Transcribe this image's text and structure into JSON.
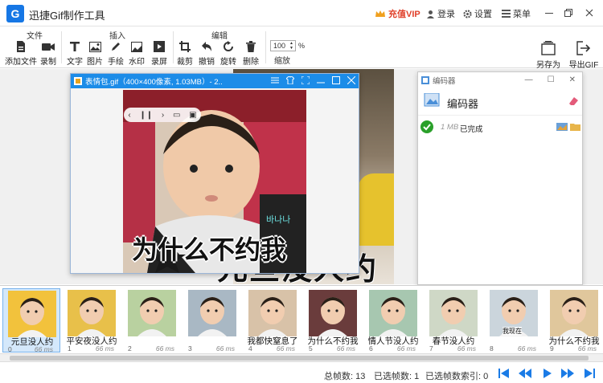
{
  "app": {
    "title": "迅捷Gif制作工具",
    "logo_letter": "G",
    "vip_label": "充值VIP",
    "login_label": "登录",
    "settings_label": "设置",
    "menu_label": "菜单"
  },
  "toolbar": {
    "groups": {
      "file": "文件",
      "insert": "插入",
      "edit": "编辑"
    },
    "add_file": "添加文件",
    "record": "录制",
    "text": "文字",
    "image": "图片",
    "draw": "手绘",
    "watermark": "水印",
    "screen_record": "录屏",
    "crop": "裁剪",
    "undo": "撤销",
    "rotate": "旋转",
    "delete": "删除",
    "zoom_value": "100",
    "zoom_unit": "%",
    "zoom_label": "缩放",
    "save_as": "另存为",
    "export_gif": "导出GIF"
  },
  "preview": {
    "title": "表情包.gif（400×400像素, 1.03MB）- 2...",
    "caption": "为什么不约我",
    "background_caption": "元旦没人约"
  },
  "encoder": {
    "window_label": "编码器",
    "title": "编码器",
    "size": "1 MB",
    "status": "已完成"
  },
  "frames": [
    {
      "index": "0",
      "caption": "元旦没人约",
      "ms": "66 ms",
      "tone": "#f2c23c"
    },
    {
      "index": "1",
      "caption": "平安夜没人约",
      "ms": "66 ms",
      "tone": "#e8c04a"
    },
    {
      "index": "2",
      "caption": "",
      "ms": "66 ms",
      "tone": "#b9d1a0"
    },
    {
      "index": "3",
      "caption": "",
      "ms": "66 ms",
      "tone": "#a9b8c4"
    },
    {
      "index": "4",
      "caption": "我都快窒息了",
      "ms": "66 ms",
      "tone": "#d8c2a8"
    },
    {
      "index": "5",
      "caption": "为什么不约我",
      "ms": "66 ms",
      "tone": "#6a3c3c"
    },
    {
      "index": "6",
      "caption": "情人节没人约",
      "ms": "66 ms",
      "tone": "#a7c7b0"
    },
    {
      "index": "7",
      "caption": "春节没人约",
      "ms": "66 ms",
      "tone": "#cfd8c6"
    },
    {
      "index": "8",
      "caption": "",
      "ms": "66 ms",
      "tone": "#cbd5dc"
    },
    {
      "index": "9",
      "caption": "为什么不约我",
      "ms": "66 ms",
      "tone": "#e0c79c"
    }
  ],
  "frame_overlay_labels": {
    "frame8": "我现在"
  },
  "status": {
    "total_frames": "总帧数: 13",
    "selected_frames": "已选帧数: 1",
    "selected_index": "已选帧数索引: 0"
  },
  "colors": {
    "accent": "#1677e5",
    "vip": "#e0402a",
    "nav": "#1a7be6",
    "success": "#2aa02a"
  }
}
